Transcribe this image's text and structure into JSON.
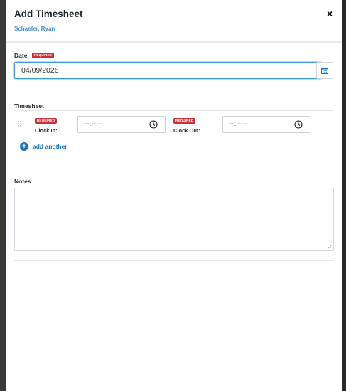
{
  "modal": {
    "title": "Add Timesheet",
    "subtitle": "Schaefer, Ryan",
    "close_label": "×"
  },
  "date": {
    "label": "Date",
    "required": "REQUIRED",
    "value": "04/09/2026"
  },
  "timesheet": {
    "label": "Timesheet",
    "clock_in": {
      "required": "REQUIRED",
      "label": "Clock In:",
      "placeholder": "--:-- --"
    },
    "clock_out": {
      "required": "REQUIRED",
      "label": "Clock Out:",
      "placeholder": "--:-- --"
    },
    "add_another": "add another"
  },
  "notes": {
    "label": "Notes",
    "value": ""
  },
  "colors": {
    "accent": "#1d74b8",
    "required_badge": "#c9303a",
    "subtitle": "#4a8fbd",
    "focus_border": "#3b9bd2"
  },
  "icons": [
    "close-icon",
    "calendar-icon",
    "drag-handle-icon",
    "clock-icon",
    "plus-circle-icon",
    "resize-handle-icon"
  ]
}
